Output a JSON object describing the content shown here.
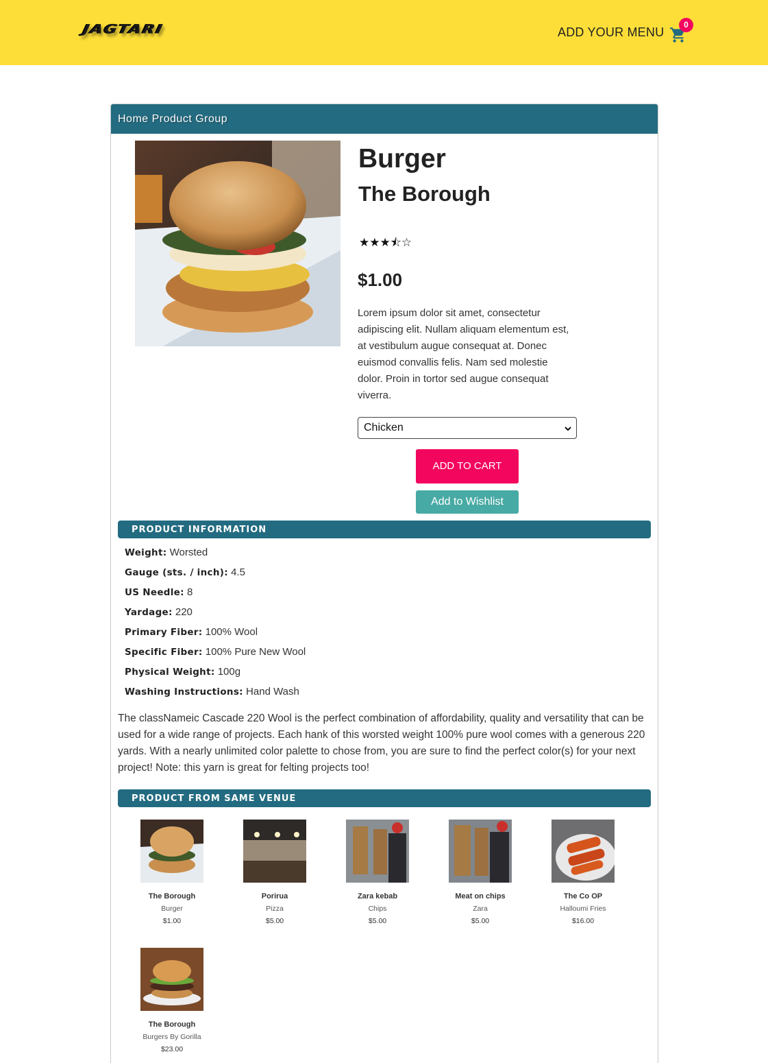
{
  "header": {
    "logo_text": "JAGTARI",
    "add_menu_label": "ADD YOUR MENU",
    "cart_count": "0"
  },
  "breadcrumb": "Home Product Group",
  "product": {
    "category": "Burger",
    "name": "The Borough",
    "rating_stars": "★★★⯪☆",
    "rating": 3.5,
    "price": "$1.00",
    "description": "Lorem ipsum dolor sit amet, consectetur adipiscing elit. Nullam aliquam elementum est, at vestibulum augue consequat at. Donec euismod convallis felis. Nam sed molestie dolor. Proin in tortor sed augue consequat viverra.",
    "option_selected": "Chicken",
    "add_to_cart_label": "ADD TO CART",
    "add_to_wishlist_label": "Add to Wishlist"
  },
  "product_info": {
    "heading": "PRODUCT INFORMATION",
    "specs": [
      {
        "label": "Weight:",
        "value": "Worsted"
      },
      {
        "label": "Gauge (sts. / inch):",
        "value": "4.5"
      },
      {
        "label": "US Needle:",
        "value": "8"
      },
      {
        "label": "Yardage:",
        "value": "220"
      },
      {
        "label": "Primary Fiber:",
        "value": "100% Wool"
      },
      {
        "label": "Specific Fiber:",
        "value": "100% Pure New Wool"
      },
      {
        "label": "Physical Weight:",
        "value": "100g"
      },
      {
        "label": "Washing Instructions:",
        "value": "Hand Wash"
      }
    ],
    "long_description": "The classNameic Cascade 220 Wool is the perfect combination of affordability, quality and versatility that can be used for a wide range of projects. Each hank of this worsted weight 100% pure wool comes with a generous 220 yards. With a nearly unlimited color palette to chose from, you are sure to find the perfect color(s) for your next project! Note: this yarn is great for felting projects too!"
  },
  "same_venue": {
    "heading": "PRODUCT FROM SAME VENUE",
    "items": [
      {
        "name": "The Borough",
        "category": "Burger",
        "price": "$1.00"
      },
      {
        "name": "Porirua",
        "category": "Pizza",
        "price": "$5.00"
      },
      {
        "name": "Zara kebab",
        "category": "Chips",
        "price": "$5.00"
      },
      {
        "name": "Meat on chips",
        "category": "Zara",
        "price": "$5.00"
      },
      {
        "name": "The Co OP",
        "category": "Halloumi Fries",
        "price": "$16.00"
      },
      {
        "name": "The Borough",
        "category": "Burgers By Gorilla",
        "price": "$23.00"
      }
    ]
  },
  "colors": {
    "header_bg": "#fdde38",
    "accent_teal": "#236b80",
    "cart_button": "#f2065e",
    "wishlist_button": "#48aaa4"
  }
}
